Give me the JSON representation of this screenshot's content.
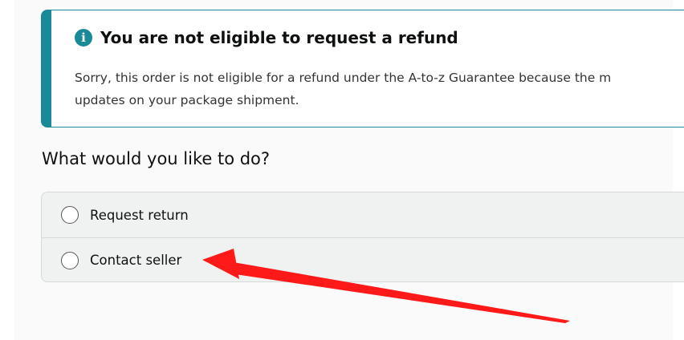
{
  "alert": {
    "icon": "info-icon",
    "icon_glyph": "i",
    "title": "You are not eligible to request a refund",
    "body_line1": "Sorry, this order is not eligible for a refund under the A-to-z Guarantee because the m",
    "body_line2": "updates on your package shipment.",
    "accent_color": "#1a8a99"
  },
  "question": "What would you like to do?",
  "options": [
    {
      "label": "Request return",
      "selected": false
    },
    {
      "label": "Contact seller",
      "selected": false
    }
  ],
  "annotation": {
    "type": "arrow",
    "color": "#ff1a1a",
    "target": "Contact seller"
  }
}
